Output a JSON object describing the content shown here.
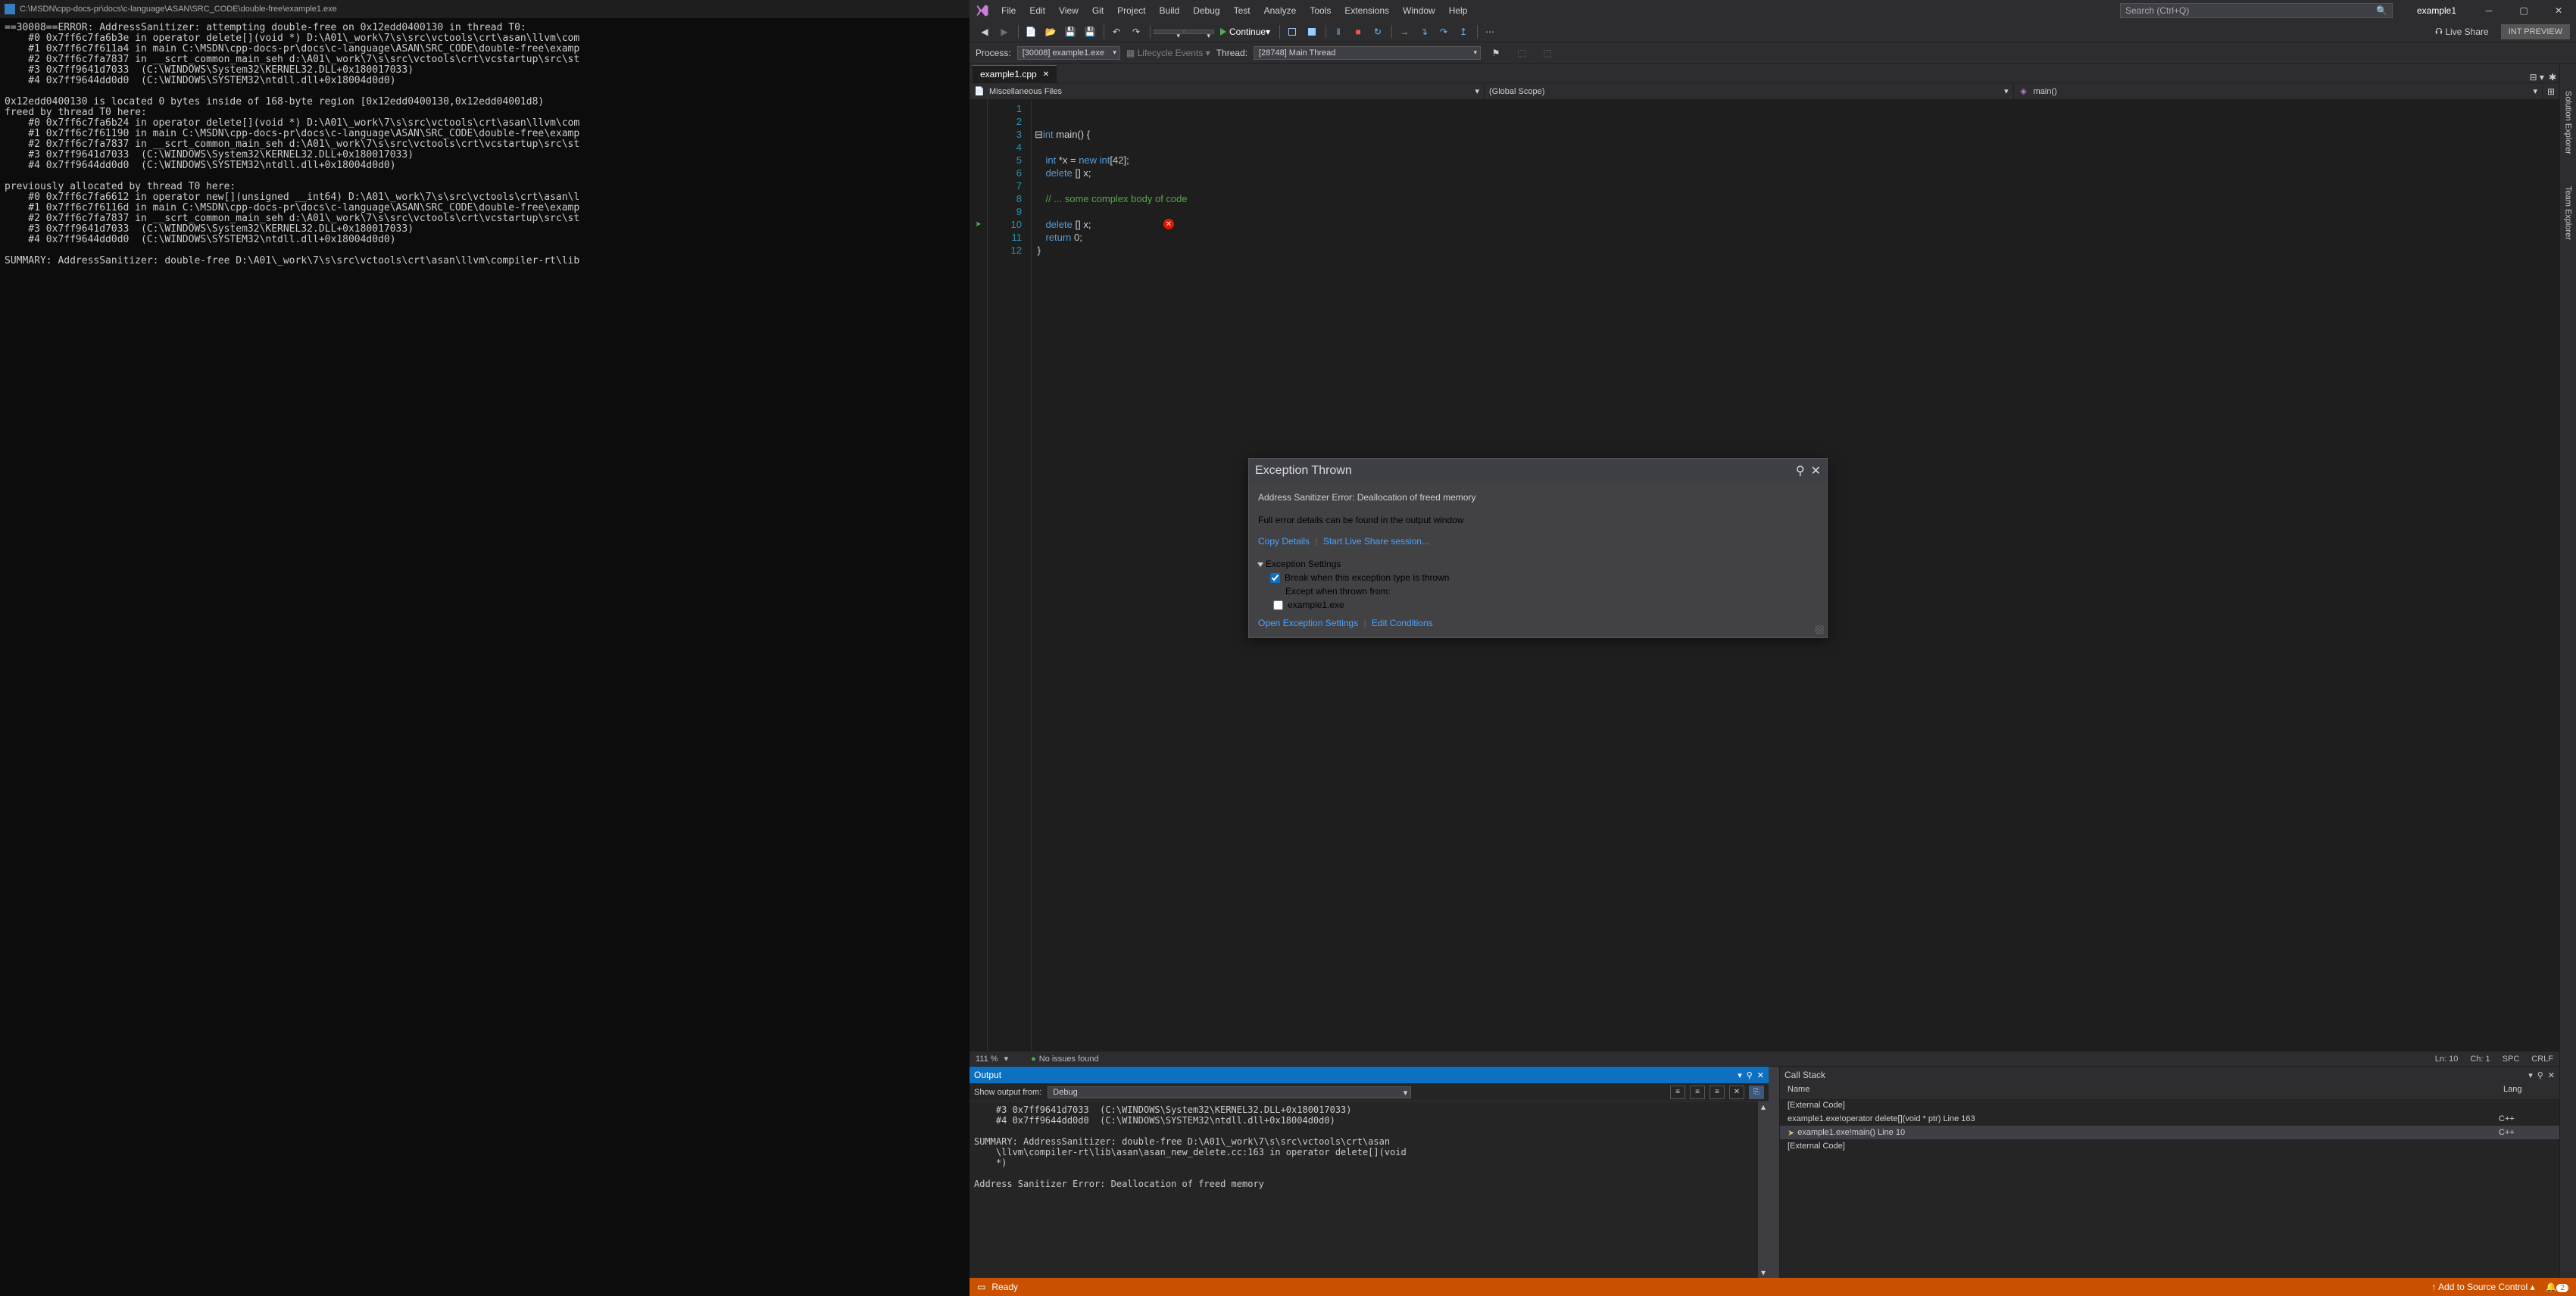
{
  "cmd": {
    "title": "C:\\MSDN\\cpp-docs-pr\\docs\\c-language\\ASAN\\SRC_CODE\\double-free\\example1.exe",
    "lines": [
      "==30008==ERROR: AddressSanitizer: attempting double-free on 0x12edd0400130 in thread T0:",
      "    #0 0x7ff6c7fa6b3e in operator delete[](void *) D:\\A01\\_work\\7\\s\\src\\vctools\\crt\\asan\\llvm\\com",
      "    #1 0x7ff6c7f611a4 in main C:\\MSDN\\cpp-docs-pr\\docs\\c-language\\ASAN\\SRC_CODE\\double-free\\examp",
      "    #2 0x7ff6c7fa7837 in __scrt_common_main_seh d:\\A01\\_work\\7\\s\\src\\vctools\\crt\\vcstartup\\src\\st",
      "    #3 0x7ff9641d7033  (C:\\WINDOWS\\System32\\KERNEL32.DLL+0x180017033)",
      "    #4 0x7ff9644dd0d0  (C:\\WINDOWS\\SYSTEM32\\ntdll.dll+0x18004d0d0)",
      "",
      "0x12edd0400130 is located 0 bytes inside of 168-byte region [0x12edd0400130,0x12edd04001d8)",
      "freed by thread T0 here:",
      "    #0 0x7ff6c7fa6b24 in operator delete[](void *) D:\\A01\\_work\\7\\s\\src\\vctools\\crt\\asan\\llvm\\com",
      "    #1 0x7ff6c7f61190 in main C:\\MSDN\\cpp-docs-pr\\docs\\c-language\\ASAN\\SRC_CODE\\double-free\\examp",
      "    #2 0x7ff6c7fa7837 in __scrt_common_main_seh d:\\A01\\_work\\7\\s\\src\\vctools\\crt\\vcstartup\\src\\st",
      "    #3 0x7ff9641d7033  (C:\\WINDOWS\\System32\\KERNEL32.DLL+0x180017033)",
      "    #4 0x7ff9644dd0d0  (C:\\WINDOWS\\SYSTEM32\\ntdll.dll+0x18004d0d0)",
      "",
      "previously allocated by thread T0 here:",
      "    #0 0x7ff6c7fa6612 in operator new[](unsigned __int64) D:\\A01\\_work\\7\\s\\src\\vctools\\crt\\asan\\l",
      "    #1 0x7ff6c7f6116d in main C:\\MSDN\\cpp-docs-pr\\docs\\c-language\\ASAN\\SRC_CODE\\double-free\\examp",
      "    #2 0x7ff6c7fa7837 in __scrt_common_main_seh d:\\A01\\_work\\7\\s\\src\\vctools\\crt\\vcstartup\\src\\st",
      "    #3 0x7ff9641d7033  (C:\\WINDOWS\\System32\\KERNEL32.DLL+0x180017033)",
      "    #4 0x7ff9644dd0d0  (C:\\WINDOWS\\SYSTEM32\\ntdll.dll+0x18004d0d0)",
      "",
      "SUMMARY: AddressSanitizer: double-free D:\\A01\\_work\\7\\s\\src\\vctools\\crt\\asan\\llvm\\compiler-rt\\lib"
    ]
  },
  "menu": [
    "File",
    "Edit",
    "View",
    "Git",
    "Project",
    "Build",
    "Debug",
    "Test",
    "Analyze",
    "Tools",
    "Extensions",
    "Window",
    "Help"
  ],
  "search_placeholder": "Search (Ctrl+Q)",
  "solution_name": "example1",
  "continue_label": "Continue",
  "live_share": "Live Share",
  "preview": "INT PREVIEW",
  "proc": {
    "proc_label": "Process:",
    "proc_val": "[30008] example1.exe",
    "life_label": "Lifecycle Events",
    "thread_label": "Thread:",
    "thread_val": "[28748] Main Thread"
  },
  "tab": {
    "name": "example1.cpp"
  },
  "scope": {
    "files": "Miscellaneous Files",
    "global": "(Global Scope)",
    "func": "main()"
  },
  "code_lines": [
    "1",
    "2",
    "3",
    "4",
    "5",
    "6",
    "7",
    "8",
    "9",
    "10",
    "11",
    "12"
  ],
  "code_status": {
    "zoom": "111 %",
    "issues": "No issues found",
    "ln": "Ln: 10",
    "ch": "Ch: 1",
    "spc": "SPC",
    "crlf": "CRLF"
  },
  "exception": {
    "title": "Exception Thrown",
    "err": "Address Sanitizer Error: Deallocation of freed memory",
    "detail": "Full error details can be found in the output window",
    "copy": "Copy Details",
    "live": "Start Live Share session...",
    "settings_hdr": "Exception Settings",
    "break": "Break when this exception type is thrown",
    "except": "Except when thrown from:",
    "module": "example1.exe",
    "open": "Open Exception Settings",
    "edit": "Edit Conditions"
  },
  "output": {
    "title": "Output",
    "show_from": "Show output from:",
    "show_val": "Debug",
    "lines": [
      "    #3 0x7ff9641d7033  (C:\\WINDOWS\\System32\\KERNEL32.DLL+0x180017033)",
      "    #4 0x7ff9644dd0d0  (C:\\WINDOWS\\SYSTEM32\\ntdll.dll+0x18004d0d0)",
      "",
      "SUMMARY: AddressSanitizer: double-free D:\\A01\\_work\\7\\s\\src\\vctools\\crt\\asan",
      "    \\llvm\\compiler-rt\\lib\\asan\\asan_new_delete.cc:163 in operator delete[](void",
      "    *)",
      "",
      "Address Sanitizer Error: Deallocation of freed memory"
    ]
  },
  "callstack": {
    "title": "Call Stack",
    "col_name": "Name",
    "col_lang": "Lang",
    "rows": [
      {
        "name": "[External Code]",
        "lang": ""
      },
      {
        "name": "example1.exe!operator delete[](void * ptr) Line 163",
        "lang": "C++"
      },
      {
        "name": "example1.exe!main() Line 10",
        "lang": "C++",
        "active": true
      },
      {
        "name": "[External Code]",
        "lang": ""
      }
    ]
  },
  "sidetabs": [
    "Solution Explorer",
    "Team Explorer"
  ],
  "status": {
    "ready": "Ready",
    "add_src": "Add to Source Control",
    "bell": "2"
  }
}
